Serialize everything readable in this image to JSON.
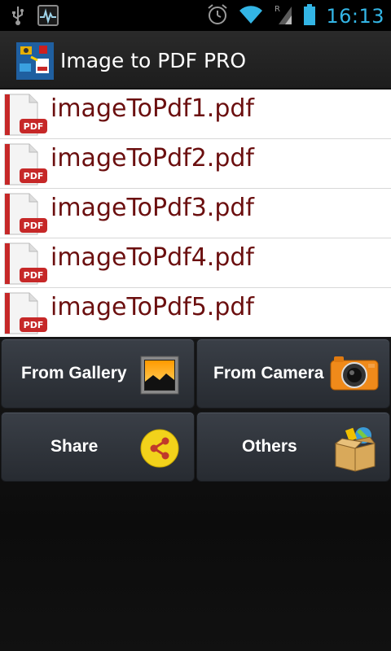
{
  "status_bar": {
    "time": "16:13",
    "icons": [
      "usb-icon",
      "activity-monitor-icon",
      "alarm-icon",
      "wifi-icon",
      "signal-icon",
      "battery-icon"
    ],
    "accent_color": "#33b5e5"
  },
  "action_bar": {
    "title": "Image to PDF PRO",
    "logo_icon": "app-logo-icon"
  },
  "file_list": {
    "items": [
      {
        "name": "imageToPdf1.pdf",
        "icon": "pdf-file-icon"
      },
      {
        "name": "imageToPdf2.pdf",
        "icon": "pdf-file-icon"
      },
      {
        "name": "imageToPdf3.pdf",
        "icon": "pdf-file-icon"
      },
      {
        "name": "imageToPdf4.pdf",
        "icon": "pdf-file-icon"
      },
      {
        "name": "imageToPdf5.pdf",
        "icon": "pdf-file-icon"
      }
    ],
    "text_color": "#6b0f0f",
    "pdf_badge": "PDF"
  },
  "buttons": {
    "from_gallery": {
      "label": "From Gallery",
      "icon": "gallery-icon"
    },
    "from_camera": {
      "label": "From Camera",
      "icon": "camera-icon"
    },
    "share": {
      "label": "Share",
      "icon": "share-icon"
    },
    "others": {
      "label": "Others",
      "icon": "box-icon"
    }
  }
}
